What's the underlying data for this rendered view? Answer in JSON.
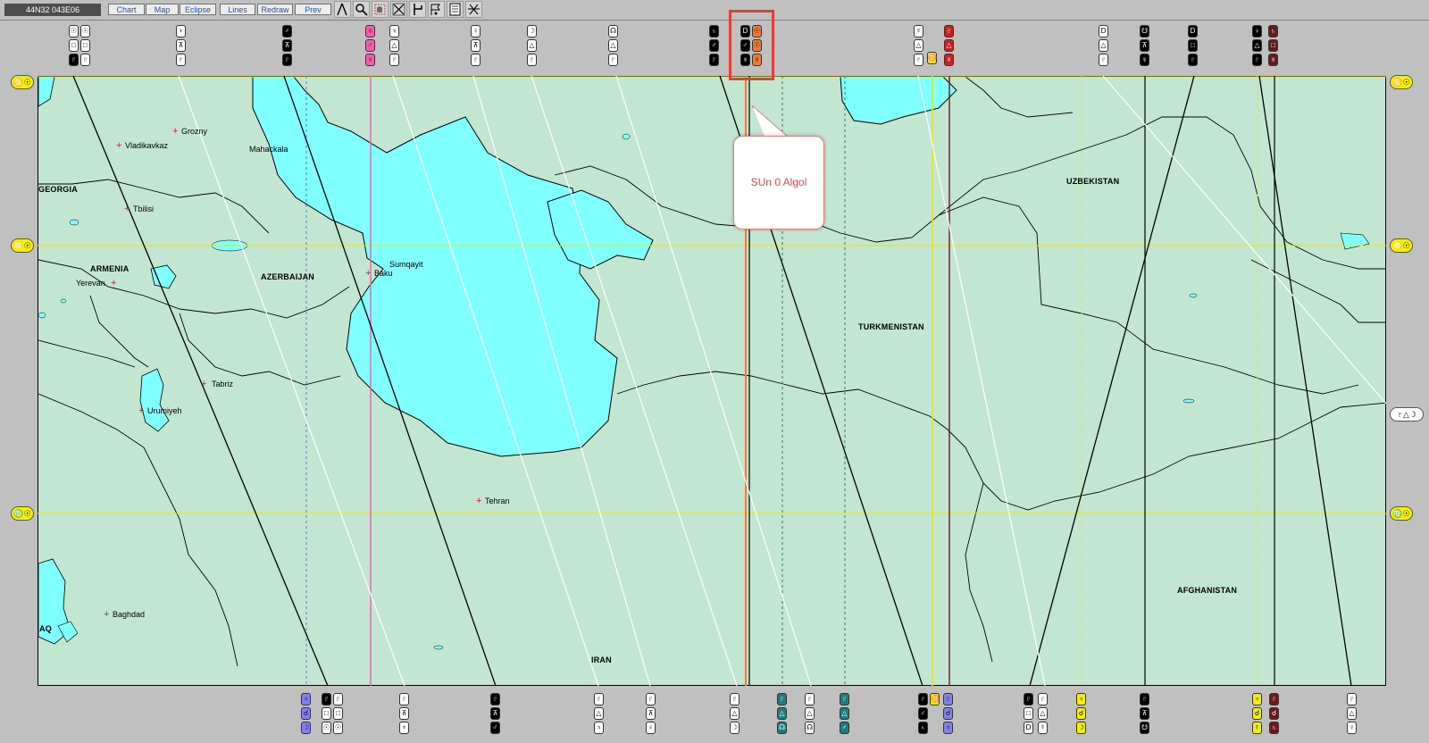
{
  "toolbar": {
    "coord_readout": "44N32 043E06",
    "buttons": {
      "chart": "Chart",
      "map": "Map",
      "eclipse": "Eclipse",
      "lines": "Lines",
      "redraw": "Redraw",
      "prev": "Prev"
    },
    "tool_icons": [
      "compass-icon",
      "magnifier-icon",
      "hand-icon",
      "cross-cut-icon",
      "paramagnet-icon",
      "point-flag-icon",
      "document-icon",
      "crossing-lines-icon"
    ]
  },
  "map": {
    "water_color": "#80ffff",
    "land_color": "#c3e6d3",
    "border_color": "#000000",
    "countries": [
      "GEORGIA",
      "ARMENIA",
      "AZERBAIJAN",
      "TURKMENISTAN",
      "UZBEKISTAN",
      "AFGHANISTAN",
      "IRAN",
      "AQ"
    ],
    "cities": [
      "Grozny",
      "Vladikavkaz",
      "Mahackala",
      "Tbilisi",
      "Sumqayit",
      "Baku",
      "Yerevan",
      "Tabriz",
      "Urumiyeh",
      "Tehran",
      "Baghdad"
    ]
  },
  "side_tags": {
    "left": [
      "♋☉",
      "♌☉",
      "♍☉"
    ],
    "right": [
      "♋☉",
      "♌☉",
      "♍☉"
    ],
    "right_mid": "♇△☽"
  },
  "callout": {
    "text": "SUn 0 Algol",
    "highlight_color": "#e0403a"
  },
  "glyph_colors": {
    "pink": "#ef60b0",
    "orange": "#f07a30",
    "yellow": "#f4f000",
    "teal": "#188080",
    "blue": "#8080ee",
    "maroon": "#6a1a1a"
  }
}
